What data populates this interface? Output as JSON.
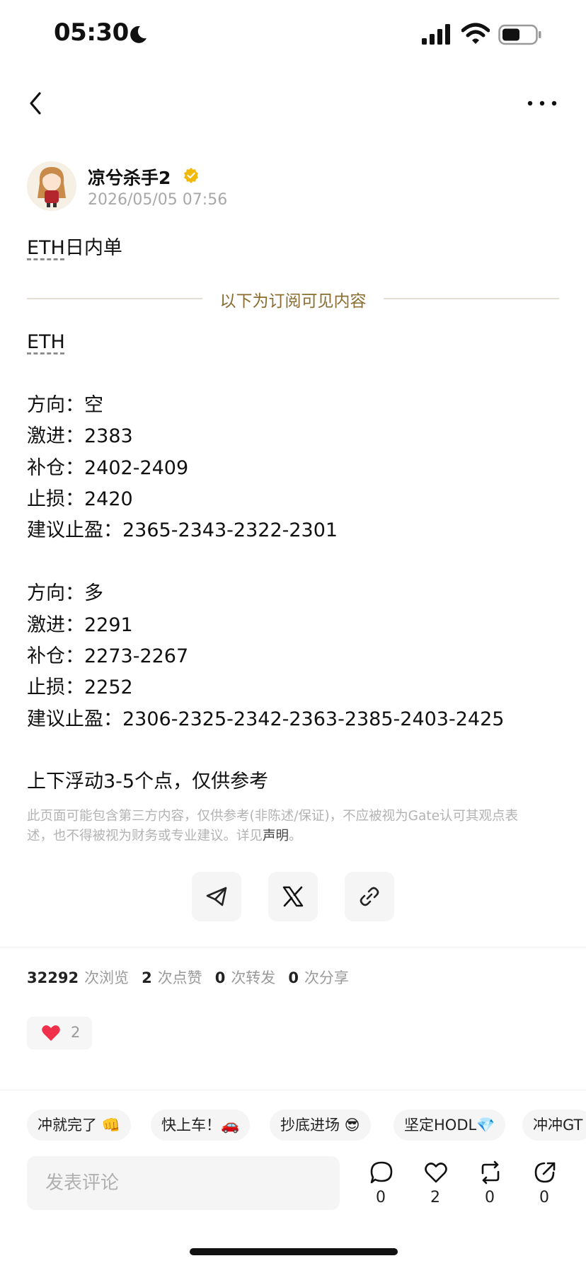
{
  "status_bar": {
    "time": "05:30"
  },
  "post": {
    "author": "凉兮杀手2",
    "timestamp": "2026/05/05 07:56",
    "title_tag": "ETH",
    "title_rest": "日内单",
    "subscription_divider": "以下为订阅可见内容",
    "content_tag": "ETH",
    "short": {
      "direction": "方向：空",
      "entry": "激进：2383",
      "add": "补仓：2402-2409",
      "stop": "止损：2420",
      "tp": "建议止盈：2365-2343-2322-2301"
    },
    "long": {
      "direction": "方向：多",
      "entry": "激进：2291",
      "add": "补仓：2273-2267",
      "stop": "止损：2252",
      "tp": "建议止盈：2306-2325-2342-2363-2385-2403-2425"
    },
    "note": "上下浮动3-5个点，仅供参考",
    "disclaimer": "此页面可能包含第三方内容，仅供参考(非陈述/保证)，不应被视为Gate认可其观点表述，也不得被视为财务或专业建议。详见",
    "disclaimer_link": "声明",
    "disclaimer_end": "。"
  },
  "stats": {
    "views": "32292",
    "views_label": "次浏览",
    "likes": "2",
    "likes_label": "次点赞",
    "reposts": "0",
    "reposts_label": "次转发",
    "shares": "0",
    "shares_label": "次分享"
  },
  "reaction": {
    "count": "2"
  },
  "quick_replies": [
    "冲就完了 👊",
    "快上车！🚗",
    "抄底进场 😎",
    "坚定HODL💎",
    "冲冲GT"
  ],
  "comment": {
    "placeholder": "发表评论"
  },
  "actions": {
    "comments": "0",
    "likes": "2",
    "reposts": "0",
    "shares": "0"
  },
  "colors": {
    "subscription_gold": "#8a6d2f",
    "verified_badge": "#f0b90b",
    "heart": "#f0304a"
  }
}
